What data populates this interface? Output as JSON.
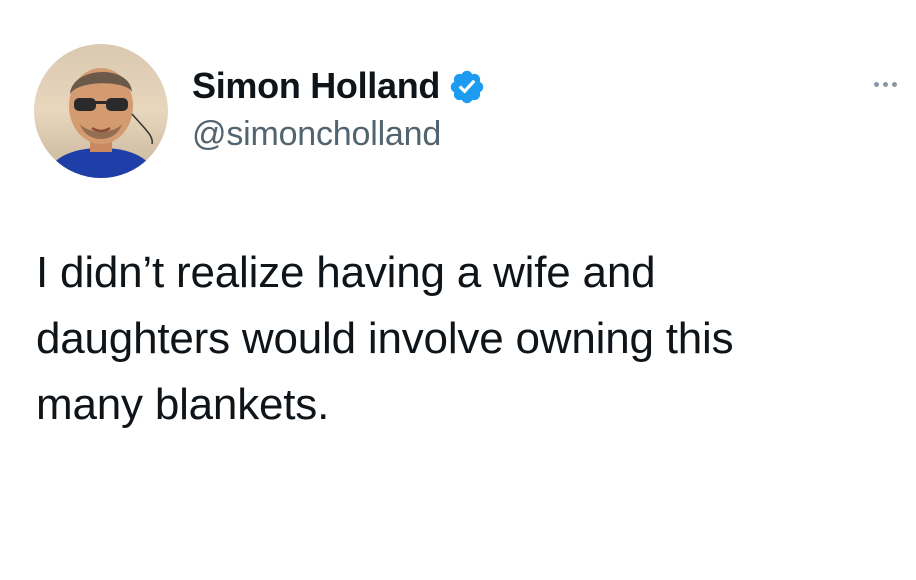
{
  "author": {
    "display_name": "Simon Holland",
    "handle": "@simoncholland",
    "verified": true,
    "verified_color": "#1d9bf0",
    "avatar_icon": "profile-photo"
  },
  "more_menu": {
    "icon": "more-horizontal-icon"
  },
  "tweet": {
    "text": "I didn’t realize having a wife and\ndaughters would involve owning this\nmany blankets."
  },
  "colors": {
    "text_primary": "#0f1419",
    "text_secondary": "#536471",
    "background": "#ffffff"
  }
}
